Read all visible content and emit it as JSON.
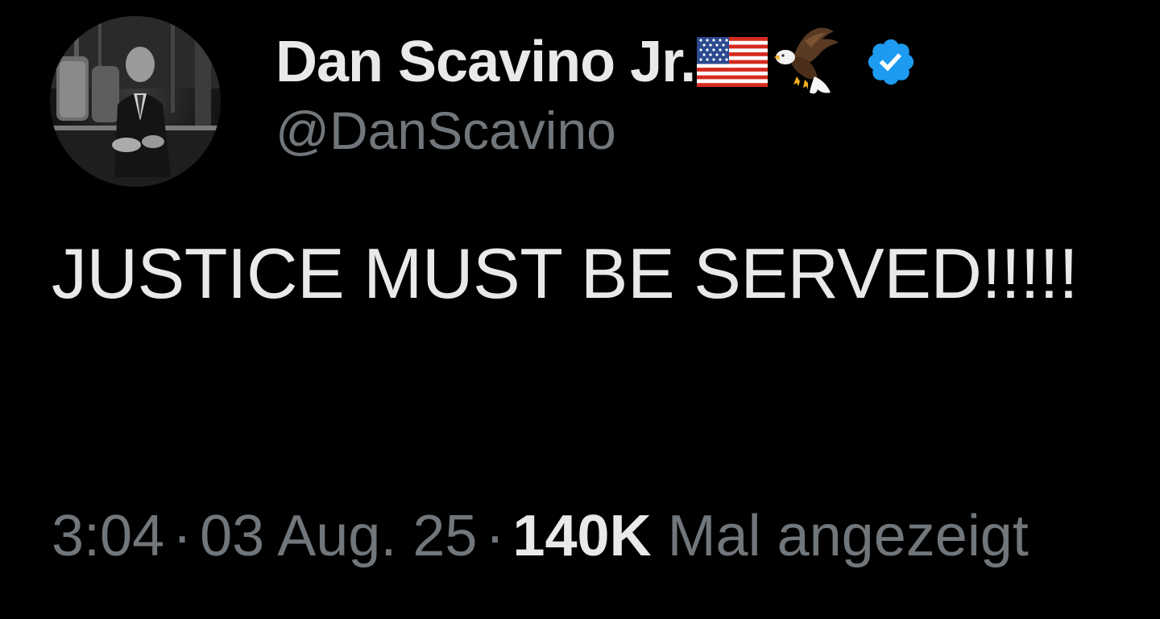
{
  "author": {
    "display_name": "Dan Scavino Jr.",
    "handle": "@DanScavino",
    "verified": true,
    "badge_color": "#1d9bf0",
    "name_emojis": [
      "flag-usa-icon",
      "eagle-icon"
    ]
  },
  "tweet": {
    "text": "JUSTICE MUST BE SERVED!!!!!"
  },
  "meta": {
    "time": "3:04",
    "separator": "·",
    "date": "03 Aug. 25",
    "views_count": "140K",
    "views_label": "Mal angezeigt"
  },
  "colors": {
    "background": "#000000",
    "primary_text": "#e7e9ea",
    "secondary_text": "#71767b"
  }
}
